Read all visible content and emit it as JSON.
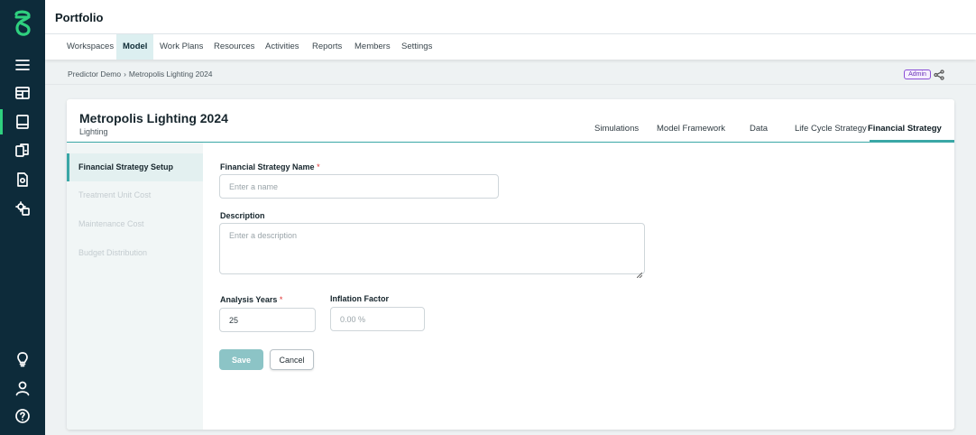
{
  "app": {
    "title": "Portfolio",
    "brand_color": "#2fd07f",
    "rail_icons": [
      "logo-icon",
      "menu-icon",
      "layout-icon",
      "model-icon",
      "files-icon",
      "document-icon",
      "settings-gear-icon",
      "lightbulb-icon",
      "user-icon",
      "help-icon"
    ]
  },
  "nav": {
    "items": [
      {
        "label": "Workspaces"
      },
      {
        "label": "Model",
        "active": true
      },
      {
        "label": "Work Plans"
      },
      {
        "label": "Resources"
      },
      {
        "label": "Activities"
      },
      {
        "label": "Reports"
      },
      {
        "label": "Members"
      },
      {
        "label": "Settings"
      }
    ]
  },
  "breadcrumb": {
    "root": "Predictor Demo",
    "separator": "›",
    "current": "Metropolis Lighting 2024",
    "badge": "Admin"
  },
  "card": {
    "title": "Metropolis Lighting 2024",
    "subtitle": "Lighting",
    "tabs": [
      {
        "label": "Simulations"
      },
      {
        "label": "Model Framework"
      },
      {
        "label": "Data"
      },
      {
        "label": "Life Cycle Strategy"
      },
      {
        "label": "Financial Strategy",
        "active": true
      }
    ],
    "accent_color": "#3aa7a6"
  },
  "side_menu": {
    "items": [
      {
        "label": "Financial Strategy Setup",
        "active": true
      },
      {
        "label": "Treatment Unit Cost"
      },
      {
        "label": "Maintenance Cost"
      },
      {
        "label": "Budget Distribution"
      }
    ]
  },
  "form": {
    "name_label": "Financial Strategy Name",
    "name_placeholder": "Enter a name",
    "description_label": "Description",
    "description_placeholder": "Enter a description",
    "years_label": "Analysis Years",
    "years_value": "25",
    "inflation_label": "Inflation Factor",
    "inflation_placeholder": "0.00 %",
    "required_mark": "*",
    "save_label": "Save",
    "cancel_label": "Cancel"
  }
}
